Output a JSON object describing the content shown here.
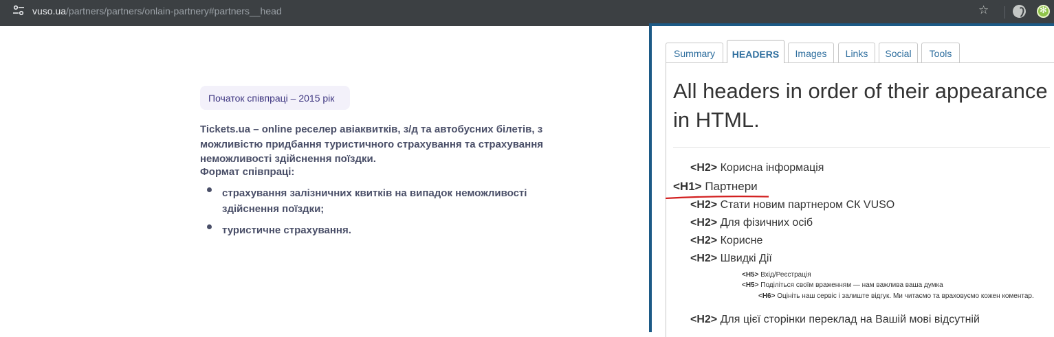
{
  "browser": {
    "url_host": "vuso.ua",
    "url_path": "/partners/partners/onlain-partnery#partners__head"
  },
  "page": {
    "badge": "Початок співпраці – 2015 рік",
    "description": "Tickets.ua – online реселер авіаквитків, з/д та автобусних білетів, з можливістю придбання туристичного страхування та страхування неможливості здійснення поїздки.",
    "format_label": "Формат співпраці:",
    "bullets": [
      "страхування залізничних квитків на випадок неможливості здійснення поїздки;",
      "туристичне страхування."
    ]
  },
  "panel": {
    "tabs": [
      "Summary",
      "HEADERS",
      "Images",
      "Links",
      "Social",
      "Tools"
    ],
    "active_tab": "HEADERS",
    "title": "All headers in order of their appearance in HTML.",
    "headers": [
      {
        "tag": "<H2>",
        "text": "Корисна інформація"
      },
      {
        "tag": "<H1>",
        "text": "Партнери"
      },
      {
        "tag": "<H2>",
        "text": "Стати новим партнером СК VUSO"
      },
      {
        "tag": "<H2>",
        "text": "Для фізичних осіб"
      },
      {
        "tag": "<H2>",
        "text": "Корисне"
      },
      {
        "tag": "<H2>",
        "text": "Швидкі Дії"
      },
      {
        "tag": "<H5>",
        "text": "Вхід/Реєстрація"
      },
      {
        "tag": "<H5>",
        "text": "Поділіться своїм враженням — нам важлива ваша думка"
      },
      {
        "tag": "<H6>",
        "text": "Оцініть наш сервіс і залиште відгук. Ми читаємо та враховуємо кожен коментар."
      },
      {
        "tag": "<H2>",
        "text": "Для цієї сторінки переклад на Вашій мові відсутній"
      }
    ]
  },
  "colors": {
    "browser_bar": "#3c4043",
    "panel_border": "#1c5a86",
    "tab_text": "#2e6e9e",
    "annotation_red": "#d21f1f"
  }
}
